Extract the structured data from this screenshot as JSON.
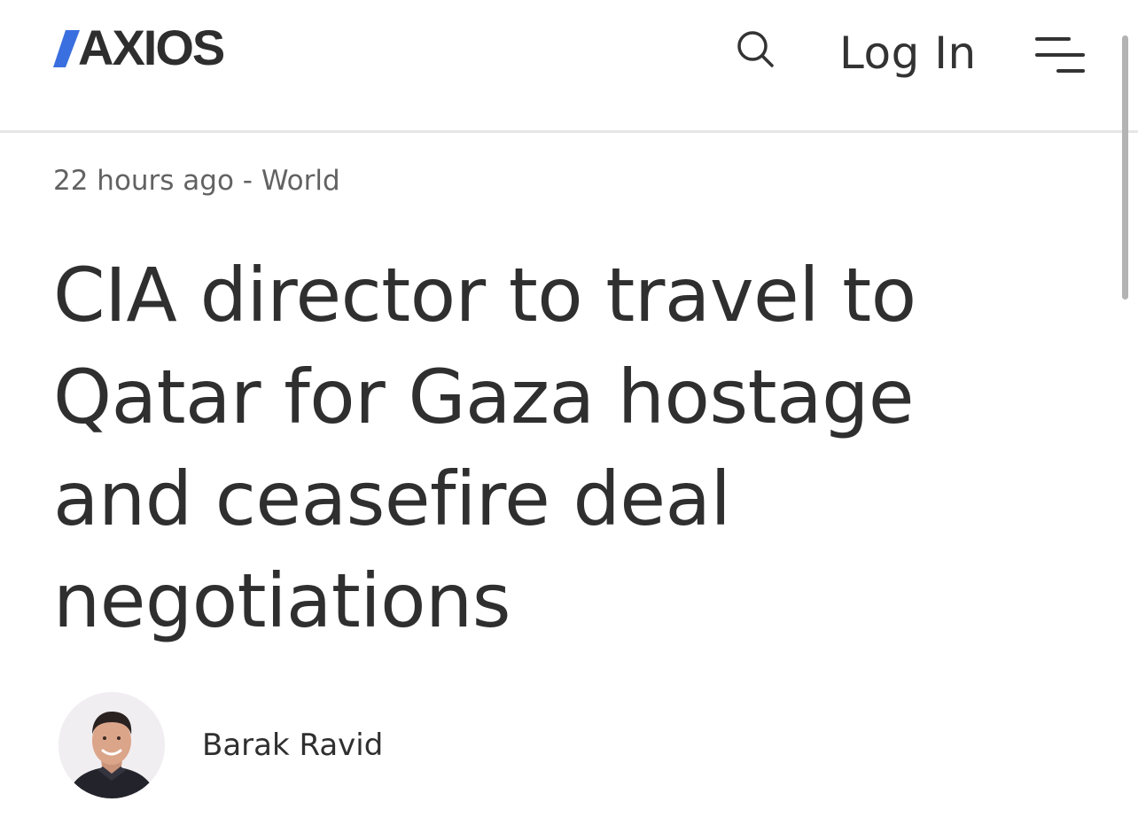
{
  "header": {
    "logo_text": "AXIOS",
    "search_icon": "search-icon",
    "login_label": "Log In",
    "menu_icon": "hamburger-menu-icon"
  },
  "article": {
    "meta": "22 hours ago - World",
    "headline": "CIA director to travel to Qatar for Gaza hostage and ceasefire deal negotiations",
    "author": "Barak Ravid"
  },
  "colors": {
    "brand_blue": "#3a6fe0",
    "text_dark": "#2f2f2f",
    "text_meta": "#626262",
    "divider": "#e6e6e6"
  }
}
